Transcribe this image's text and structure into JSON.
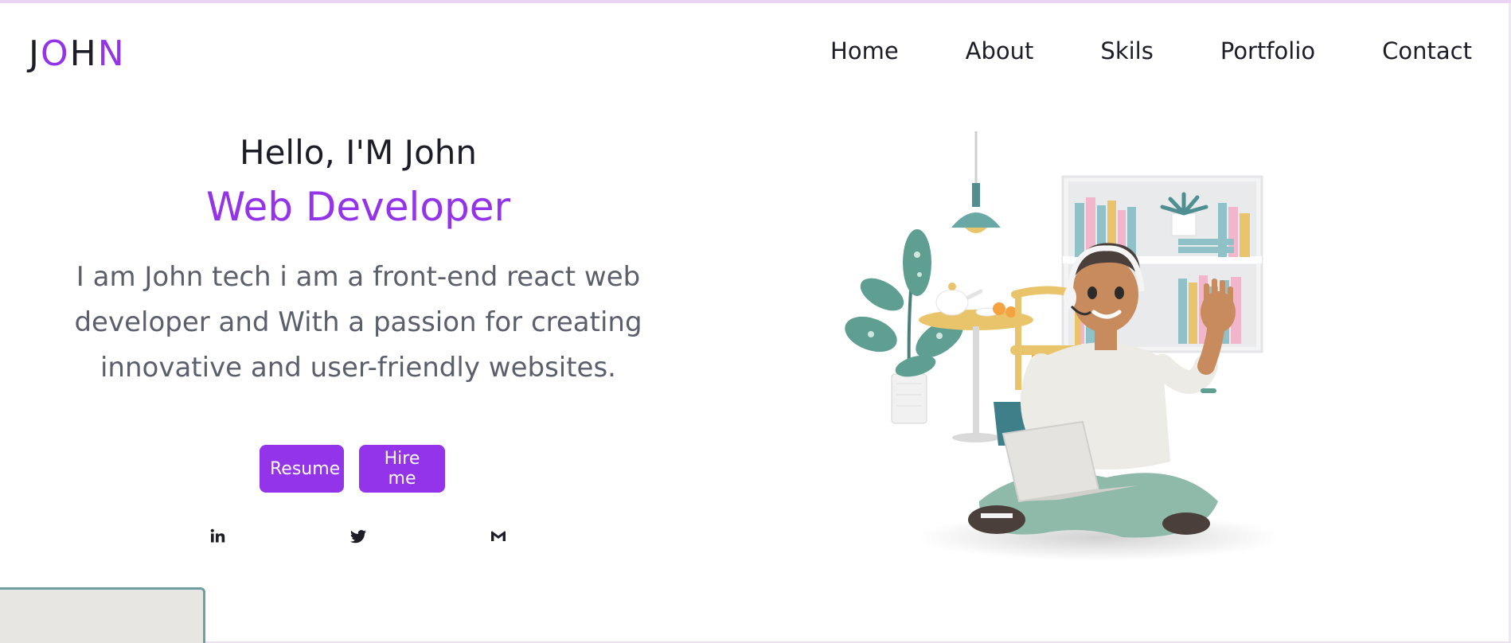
{
  "logo": {
    "letters": [
      "J",
      "O",
      "H",
      "N"
    ]
  },
  "nav": {
    "items": [
      "Home",
      "About",
      "Skils",
      "Portfolio",
      "Contact"
    ]
  },
  "hero": {
    "greeting": "Hello, I'M John",
    "role": "Web Developer",
    "description": "I am John tech i am a front-end react web developer and With a passion for creating innovative and user-friendly websites."
  },
  "buttons": {
    "resume": "Resume",
    "hire": "Hire me"
  },
  "socials": [
    "linkedin-icon",
    "twitter-icon",
    "gmail-icon"
  ],
  "colors": {
    "accent": "#9333ea",
    "text_dark": "#1d1d28",
    "text_muted": "#5b5f6b"
  },
  "illustration": {
    "subject": "3D developer with laptop waving"
  }
}
